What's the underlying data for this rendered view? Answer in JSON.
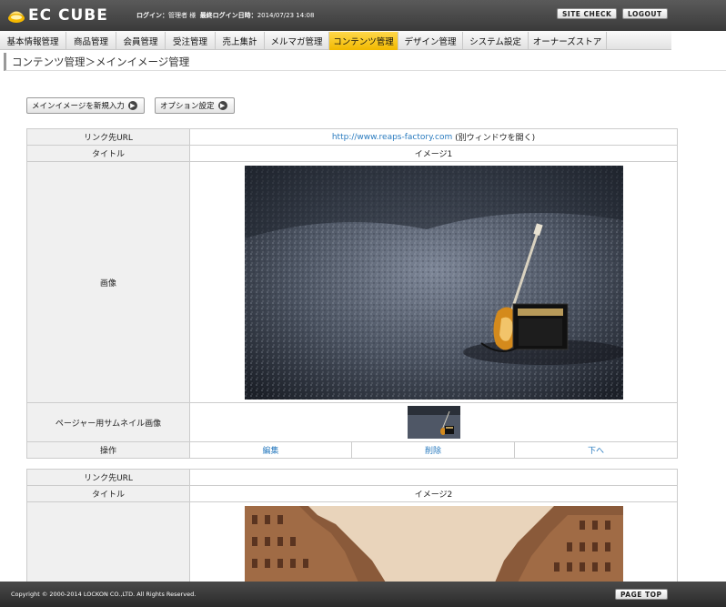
{
  "header": {
    "logo_text": "EC CUBE",
    "login_label": "ログイン：",
    "login_user": "管理者 様",
    "last_login_label": "最終ログイン日時：",
    "last_login_value": "2014/07/23 14:08",
    "site_check": "SITE CHECK",
    "logout": "LOGOUT"
  },
  "nav": [
    {
      "label": "基本情報管理"
    },
    {
      "label": "商品管理"
    },
    {
      "label": "会員管理"
    },
    {
      "label": "受注管理"
    },
    {
      "label": "売上集計"
    },
    {
      "label": "メルマガ管理"
    },
    {
      "label": "コンテンツ管理"
    },
    {
      "label": "デザイン管理"
    },
    {
      "label": "システム設定"
    },
    {
      "label": "オーナーズストア"
    }
  ],
  "breadcrumb": "コンテンツ管理＞メインイメージ管理",
  "buttons": {
    "new": "メインイメージを新規入力",
    "options": "オプション設定"
  },
  "labels": {
    "link_url": "リンク先URL",
    "title": "タイトル",
    "image": "画像",
    "thumb": "ページャー用サムネイル画像",
    "ops": "操作"
  },
  "records": [
    {
      "url": "http://www.reaps-factory.com",
      "new_window": "(別ウィンドウを開く)",
      "title": "イメージ1",
      "edit": "編集",
      "delete": "削除",
      "down": "下へ"
    },
    {
      "url": "",
      "title": "イメージ2"
    }
  ],
  "footer": {
    "copyright": "Copyright © 2000-2014 LOCKON CO.,LTD. All Rights Reserved.",
    "page_top": "PAGE TOP"
  }
}
